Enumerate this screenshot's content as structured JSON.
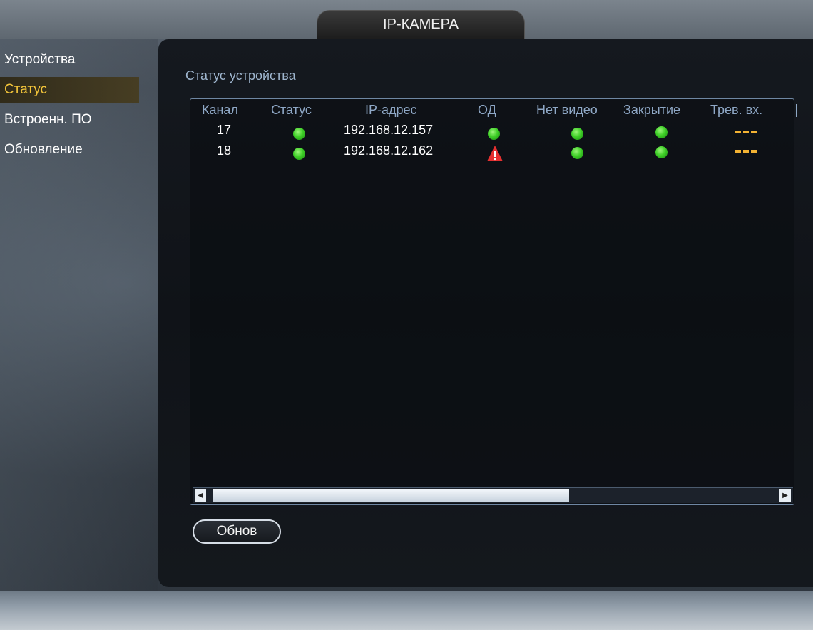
{
  "window": {
    "title": "IP-КАМЕРА"
  },
  "sidebar": {
    "items": [
      {
        "label": "Устройства",
        "active": false
      },
      {
        "label": "Статус",
        "active": true
      },
      {
        "label": "Встроенн. ПО",
        "active": false
      },
      {
        "label": "Обновление",
        "active": false
      }
    ]
  },
  "main": {
    "section_title": "Статус устройства",
    "table": {
      "columns": [
        "Канал",
        "Статус",
        "IP-адрес",
        "ОД",
        "Нет видео",
        "Закрытие",
        "Трев. вх."
      ],
      "rows": [
        {
          "channel": "17",
          "status": "ok",
          "ip": "192.168.12.157",
          "od": "ok",
          "no_video": "ok",
          "closure": "ok",
          "alarm_in": "--"
        },
        {
          "channel": "18",
          "status": "ok",
          "ip": "192.168.12.162",
          "od": "warning",
          "no_video": "ok",
          "closure": "ok",
          "alarm_in": "--"
        }
      ]
    },
    "scrollbar": {
      "position_fraction": 0.62
    },
    "refresh_button": "Обнов"
  },
  "colors": {
    "accent_active": "#f2c43a",
    "header_text": "#8fa8c6",
    "status_ok": "#3fcf28",
    "status_warning": "#e53030",
    "alarm_dash": "#f2b233"
  },
  "icons": {
    "ok": "green-dot-icon",
    "warning": "warning-triangle-icon",
    "dash": "dash-icon"
  }
}
